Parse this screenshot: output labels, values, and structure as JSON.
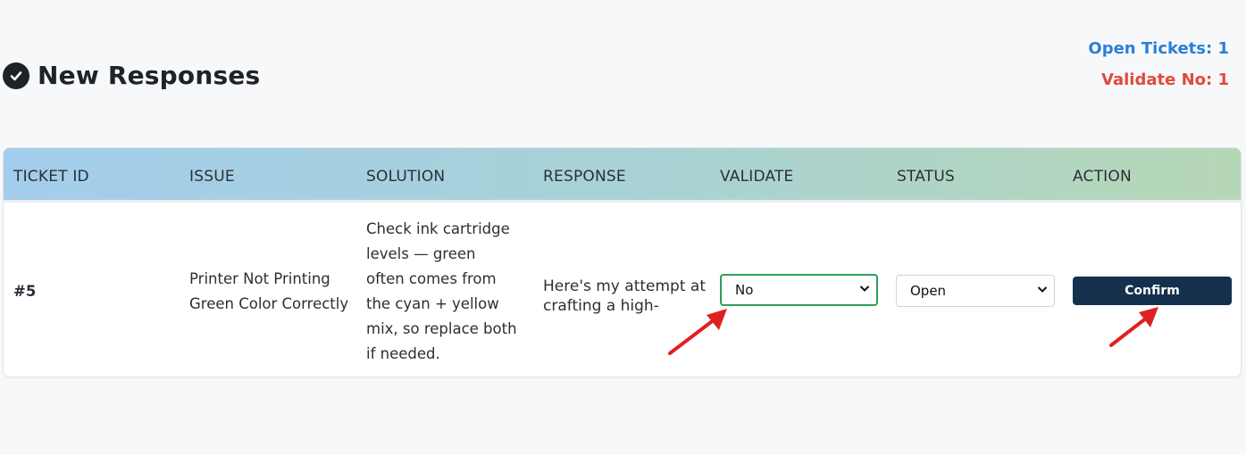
{
  "header": {
    "title": "New Responses",
    "open_tickets": "Open Tickets: 1",
    "validate_no": "Validate No: 1"
  },
  "table": {
    "columns": [
      "TICKET ID",
      "ISSUE",
      "SOLUTION",
      "RESPONSE",
      "VALIDATE",
      "STATUS",
      "ACTION"
    ],
    "rows": [
      {
        "ticket_id": "#5",
        "issue": "Printer Not Printing Green Color Correctly",
        "solution": "Check ink cartridge levels — green often comes from the cyan + yellow mix, so replace both if needed.",
        "response": "Here's my attempt at crafting a high-",
        "validate": "No",
        "status": "Open",
        "action": "Confirm"
      }
    ]
  },
  "colors": {
    "accent_blue": "#2b7fd6",
    "accent_red": "#e04a3c",
    "button_navy": "#15304d",
    "validate_border": "#2e9d5a",
    "annotation_arrow": "#e02020"
  },
  "icons": [
    "check-circle-icon",
    "chevron-down-icon",
    "annotation-arrow"
  ]
}
